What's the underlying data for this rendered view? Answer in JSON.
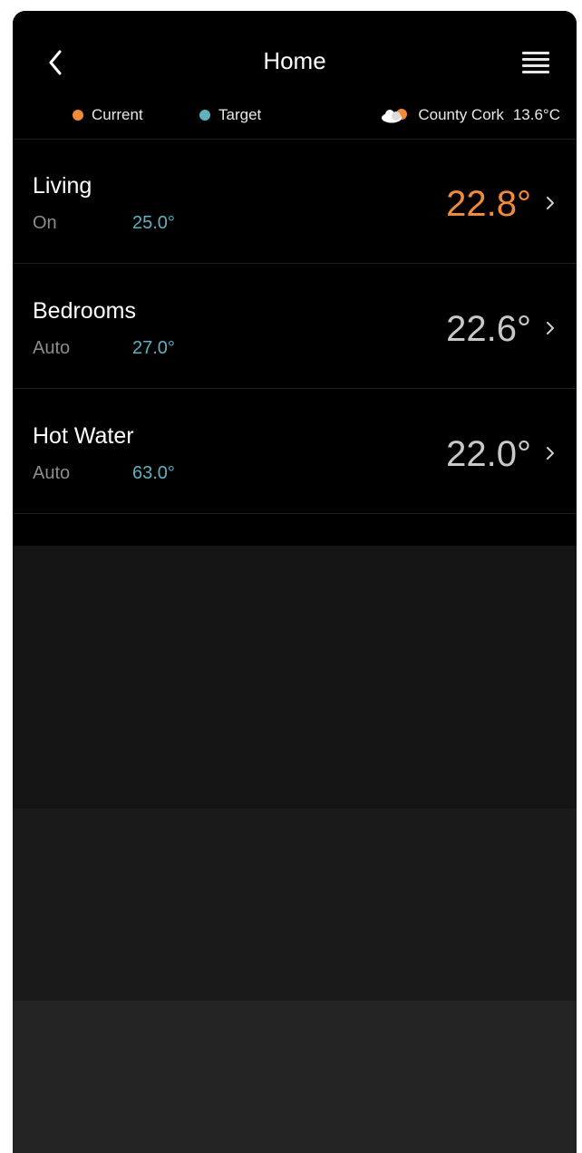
{
  "header": {
    "title": "Home"
  },
  "legend": {
    "current_label": "Current",
    "target_label": "Target",
    "current_color": "#f08b3a",
    "target_color": "#5fb1bf"
  },
  "weather": {
    "icon": "cloud-sun-icon",
    "location": "County Cork",
    "temperature": "13.6°C"
  },
  "zones": [
    {
      "name": "Living",
      "mode": "On",
      "target": "25.0°",
      "current": "22.8°",
      "heating": true
    },
    {
      "name": "Bedrooms",
      "mode": "Auto",
      "target": "27.0°",
      "current": "22.6°",
      "heating": false
    },
    {
      "name": "Hot Water",
      "mode": "Auto",
      "target": "63.0°",
      "current": "22.0°",
      "heating": false
    }
  ]
}
